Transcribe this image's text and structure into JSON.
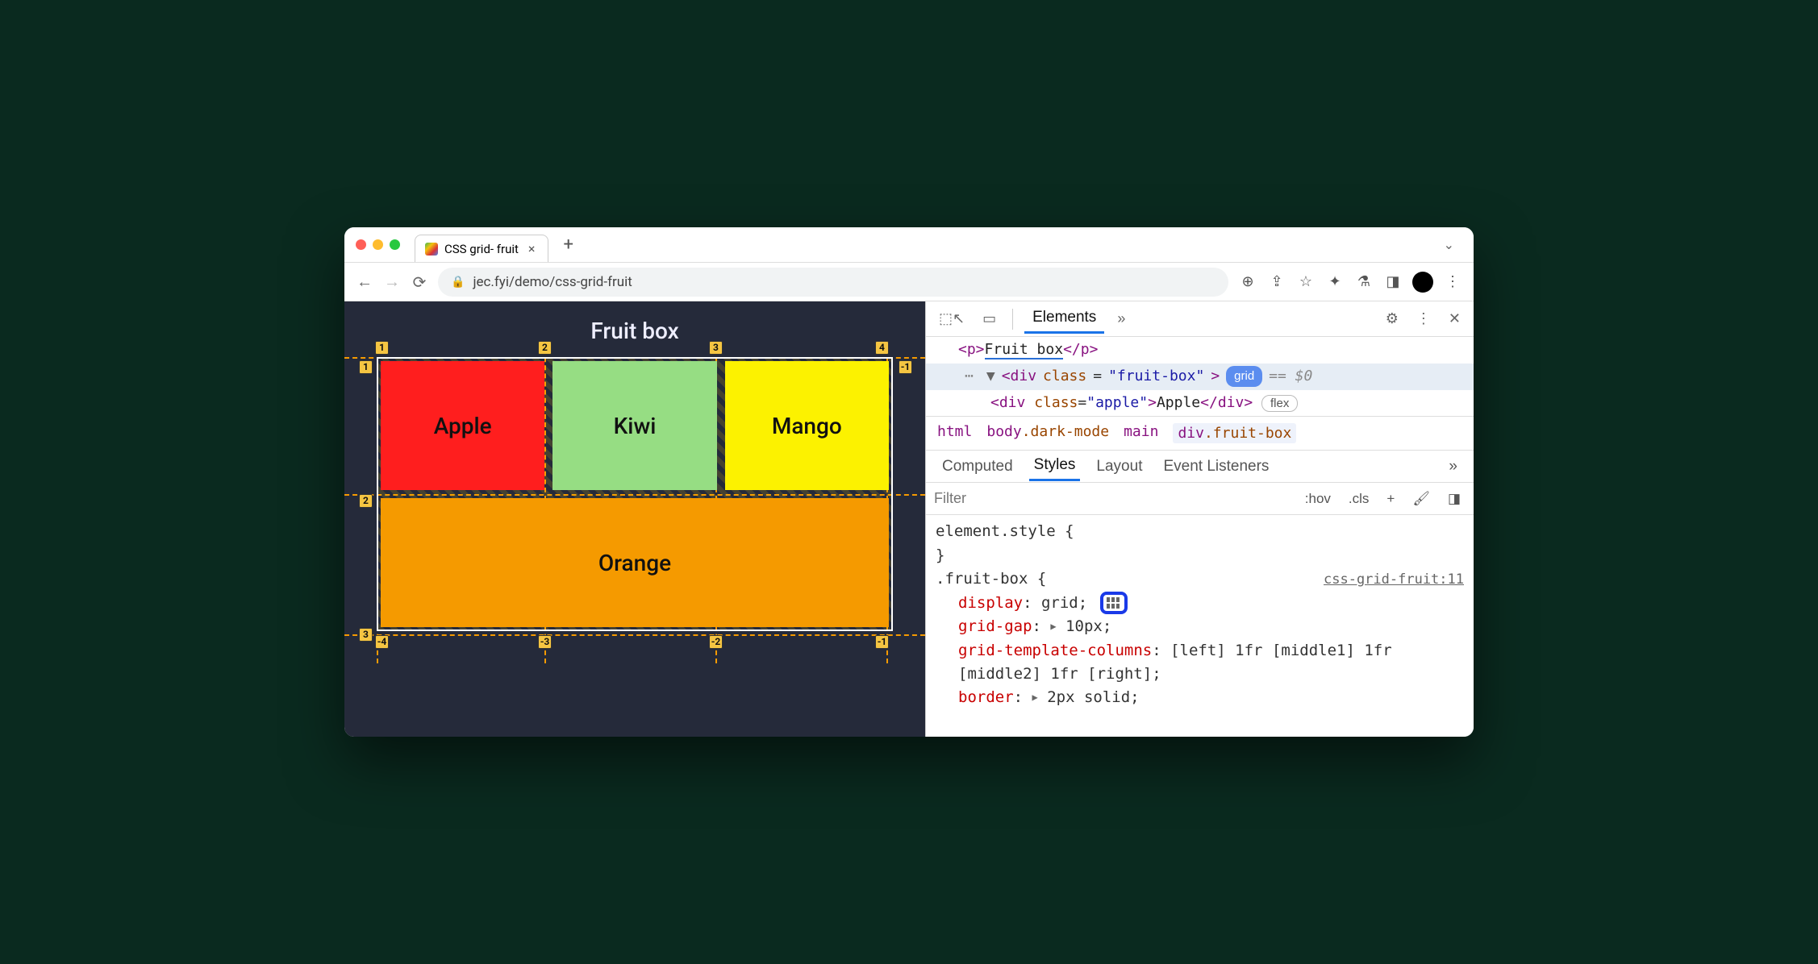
{
  "browser": {
    "tab_title": "CSS grid- fruit",
    "url_display": "jec.fyi/demo/css-grid-fruit"
  },
  "page": {
    "heading": "Fruit box",
    "cells": {
      "apple": "Apple",
      "kiwi": "Kiwi",
      "mango": "Mango",
      "orange": "Orange"
    },
    "grid_overlay": {
      "col_lines_top": [
        "1",
        "2",
        "3",
        "4"
      ],
      "row_lines_left": [
        "1",
        "2",
        "3"
      ],
      "neg_row_right_top": "-1",
      "neg_cols_bottom": [
        "-4",
        "-3",
        "-2",
        "-1"
      ]
    }
  },
  "devtools": {
    "main_tabs": {
      "active": "Elements"
    },
    "dom": {
      "line1_text": "Fruit box",
      "sel_class": "fruit-box",
      "badge_grid": "grid",
      "eq0": "== $0",
      "child_class": "apple",
      "child_text": "Apple",
      "badge_flex": "flex"
    },
    "crumbs": {
      "c1": "html",
      "c2a": "body",
      "c2b": ".dark-mode",
      "c3": "main",
      "c4a": "div",
      "c4b": ".fruit-box"
    },
    "subtabs": {
      "t1": "Computed",
      "t2": "Styles",
      "t3": "Layout",
      "t4": "Event Listeners"
    },
    "filter_placeholder": "Filter",
    "filter_pills": {
      "hov": ":hov",
      "cls": ".cls"
    },
    "styles": {
      "element_style": "element.style {",
      "close": "}",
      "selector": ".fruit-box {",
      "source": "css-grid-fruit:11",
      "p_display": "display",
      "v_display": "grid",
      "p_gap": "grid-gap",
      "v_gap": "10px",
      "p_cols": "grid-template-columns",
      "v_cols": "[left] 1fr [middle1] 1fr [middle2] 1fr [right]",
      "p_border": "border",
      "v_border": "2px solid"
    }
  }
}
